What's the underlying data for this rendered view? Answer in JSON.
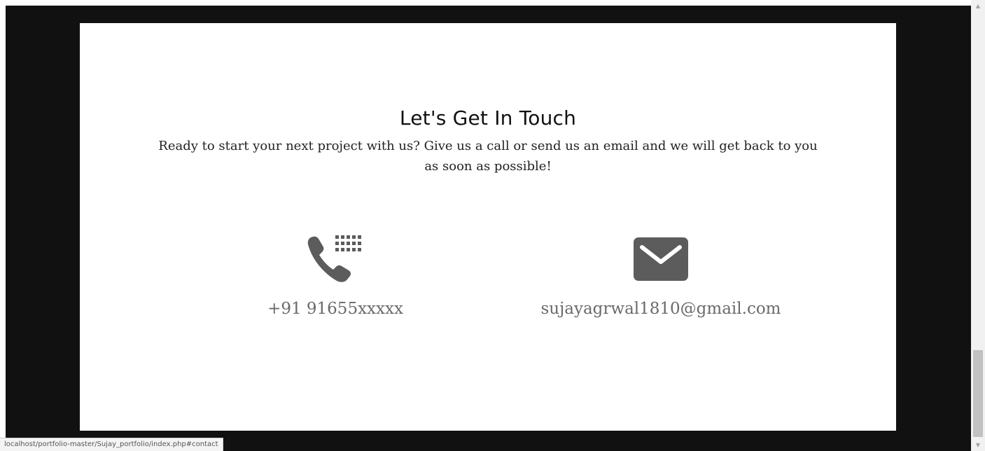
{
  "contact_section": {
    "title": "Let's Get In Touch",
    "subtitle": "Ready to start your next project with us? Give us a call or send us an email and we will get back to you as soon as possible!",
    "phone": {
      "icon": "phone-keypad-icon",
      "value": "+91 91655xxxxx"
    },
    "email": {
      "icon": "envelope-icon",
      "value": "sujayagrwal1810@gmail.com"
    }
  },
  "status_bar": {
    "url": "localhost/portfolio-master/Sujay_portfolio/index.php#contact"
  },
  "scrollbar": {
    "up_glyph": "▲",
    "down_glyph": "▼"
  },
  "colors": {
    "frame_background": "#111111",
    "card_background": "#ffffff",
    "icon_color": "#5c5c5c",
    "contact_text_color": "#6a6a6a"
  }
}
